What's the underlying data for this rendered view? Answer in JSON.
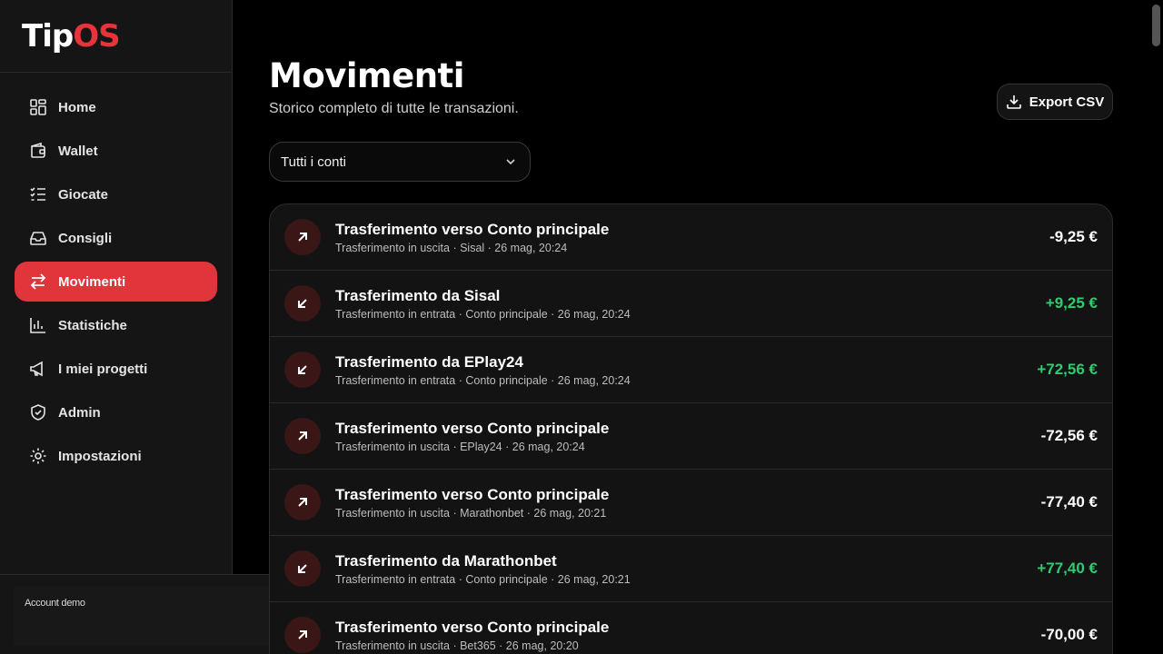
{
  "brand": {
    "part1": "Tip",
    "part2": "OS",
    "accent": "#e0353b"
  },
  "sidebar": {
    "items": [
      {
        "label": "Home",
        "icon": "dashboard-icon"
      },
      {
        "label": "Wallet",
        "icon": "wallet-icon"
      },
      {
        "label": "Giocate",
        "icon": "list-check-icon"
      },
      {
        "label": "Consigli",
        "icon": "inbox-icon"
      },
      {
        "label": "Movimenti",
        "icon": "arrows-swap-icon",
        "active": true
      },
      {
        "label": "Statistiche",
        "icon": "bar-chart-icon"
      },
      {
        "label": "I miei progetti",
        "icon": "megaphone-icon"
      },
      {
        "label": "Admin",
        "icon": "shield-check-icon"
      },
      {
        "label": "Impostazioni",
        "icon": "gear-icon"
      }
    ],
    "account_label": "Account demo"
  },
  "page": {
    "title": "Movimenti",
    "subtitle": "Storico completo di tutte le transazioni.",
    "export_label": "Export CSV",
    "filter_value": "Tutti i conti"
  },
  "transactions": [
    {
      "title": "Trasferimento verso Conto principale",
      "meta": "Trasferimento in uscita · Sisal · 26 mag, 20:24",
      "amount": "-9,25 €",
      "direction": "out"
    },
    {
      "title": "Trasferimento da Sisal",
      "meta": "Trasferimento in entrata · Conto principale · 26 mag, 20:24",
      "amount": "+9,25 €",
      "direction": "in"
    },
    {
      "title": "Trasferimento da EPlay24",
      "meta": "Trasferimento in entrata · Conto principale · 26 mag, 20:24",
      "amount": "+72,56 €",
      "direction": "in"
    },
    {
      "title": "Trasferimento verso Conto principale",
      "meta": "Trasferimento in uscita · EPlay24 · 26 mag, 20:24",
      "amount": "-72,56 €",
      "direction": "out"
    },
    {
      "title": "Trasferimento verso Conto principale",
      "meta": "Trasferimento in uscita · Marathonbet · 26 mag, 20:21",
      "amount": "-77,40 €",
      "direction": "out"
    },
    {
      "title": "Trasferimento da Marathonbet",
      "meta": "Trasferimento in entrata · Conto principale · 26 mag, 20:21",
      "amount": "+77,40 €",
      "direction": "in"
    },
    {
      "title": "Trasferimento verso Conto principale",
      "meta": "Trasferimento in uscita · Bet365 · 26 mag, 20:20",
      "amount": "-70,00 €",
      "direction": "out"
    }
  ]
}
